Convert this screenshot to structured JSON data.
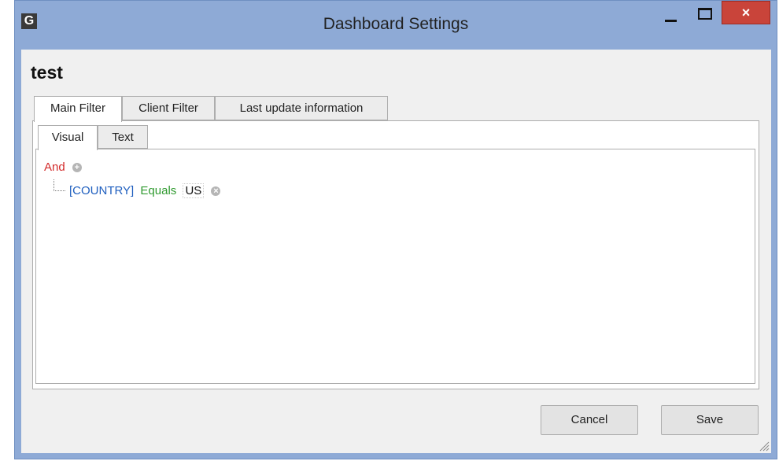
{
  "window": {
    "app_icon_letter": "G",
    "title": "Dashboard Settings",
    "close_glyph": "×",
    "colors": {
      "title_bar": "#8eaad6",
      "close_button": "#c9443a"
    }
  },
  "dialog": {
    "heading": "test",
    "tabs": [
      {
        "label": "Main Filter",
        "active": true
      },
      {
        "label": "Client Filter",
        "active": false
      },
      {
        "label": "Last update information",
        "active": false
      }
    ],
    "subtabs": [
      {
        "label": "Visual",
        "active": true
      },
      {
        "label": "Text",
        "active": false
      }
    ]
  },
  "filter": {
    "group_operator": "And",
    "add_icon": "plus-circle-icon",
    "condition": {
      "field": "[COUNTRY]",
      "operator": "Equals",
      "value": "US",
      "remove_icon": "remove-circle-icon"
    },
    "colors": {
      "group": "#d32a2a",
      "field": "#1f5fbf",
      "operator": "#2f9a2f"
    }
  },
  "buttons": {
    "cancel": "Cancel",
    "save": "Save"
  }
}
